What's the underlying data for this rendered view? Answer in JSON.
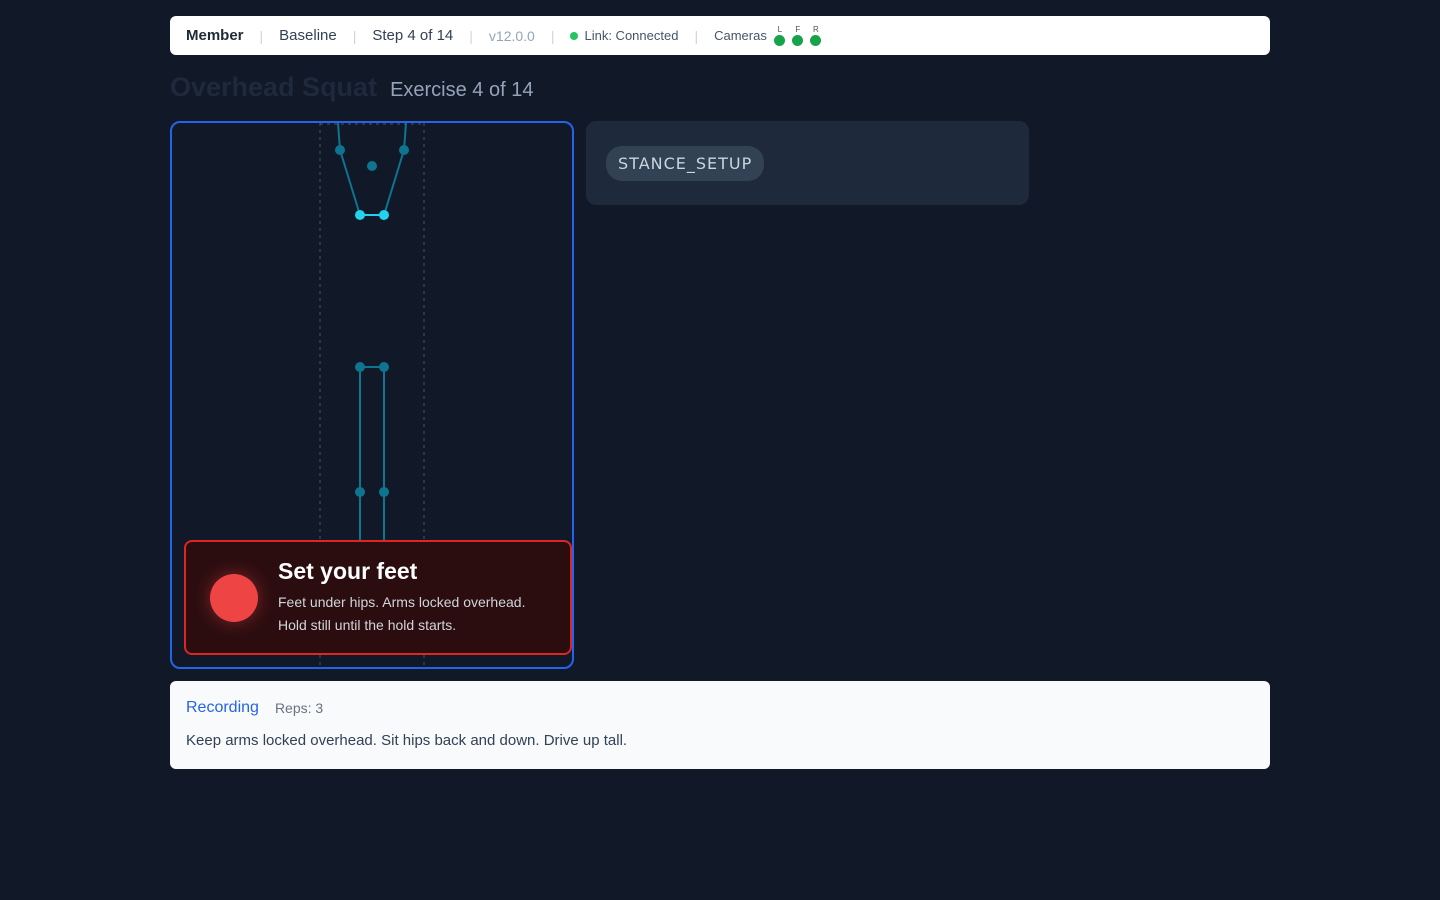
{
  "topbar": {
    "member": "Member",
    "baseline": "Baseline",
    "step": "Step 4 of 14",
    "version": "v12.0.0",
    "link": "Link: Connected",
    "cameras_label": "Cameras",
    "cameras": [
      {
        "label": "L",
        "status": "ok"
      },
      {
        "label": "F",
        "status": "ok"
      },
      {
        "label": "R",
        "status": "ok"
      }
    ],
    "separator": "|"
  },
  "heading": {
    "exercise_name": "Overhead Squat",
    "exercise_counter": "Exercise 4 of 14"
  },
  "alert": {
    "headline": "Set your feet",
    "line1": "Feet under hips. Arms locked overhead.",
    "line2": "Hold still until the hold starts."
  },
  "phase": {
    "label": "STANCE_SETUP"
  },
  "status": {
    "state": "Recording",
    "reps": "Reps: 3",
    "cue": "Keep arms locked overhead. Sit hips back and down. Drive up tall."
  },
  "colors": {
    "background": "#111827",
    "accent_blue": "#2563eb",
    "alert_red": "#ef4444",
    "camera_ok": "#16a34a",
    "skeleton": "#22d3ee"
  }
}
